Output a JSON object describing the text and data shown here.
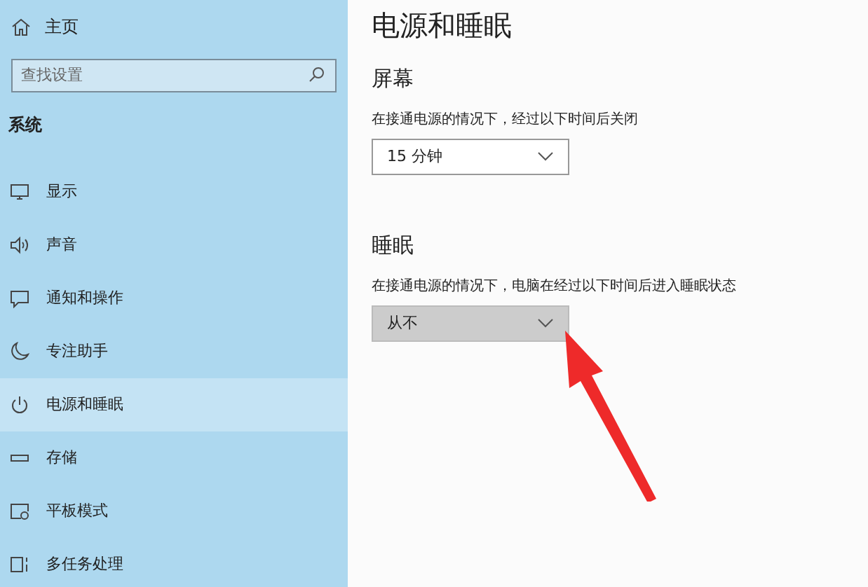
{
  "sidebar": {
    "home": "主页",
    "search": {
      "placeholder": "查找设置"
    },
    "section": "系统",
    "items": [
      {
        "label": "显示",
        "selected": false
      },
      {
        "label": "声音",
        "selected": false
      },
      {
        "label": "通知和操作",
        "selected": false
      },
      {
        "label": "专注助手",
        "selected": false
      },
      {
        "label": "电源和睡眠",
        "selected": true
      },
      {
        "label": "存储",
        "selected": false
      },
      {
        "label": "平板模式",
        "selected": false
      },
      {
        "label": "多任务处理",
        "selected": false
      }
    ]
  },
  "main": {
    "title": "电源和睡眠",
    "groups": [
      {
        "heading": "屏幕",
        "description": "在接通电源的情况下，经过以下时间后关闭",
        "dropdown": {
          "value": "15 分钟",
          "hovered": false
        }
      },
      {
        "heading": "睡眠",
        "description": "在接通电源的情况下，电脑在经过以下时间后进入睡眠状态",
        "dropdown": {
          "value": "从不",
          "hovered": true
        }
      }
    ]
  },
  "annotation": {
    "kind": "arrow"
  }
}
